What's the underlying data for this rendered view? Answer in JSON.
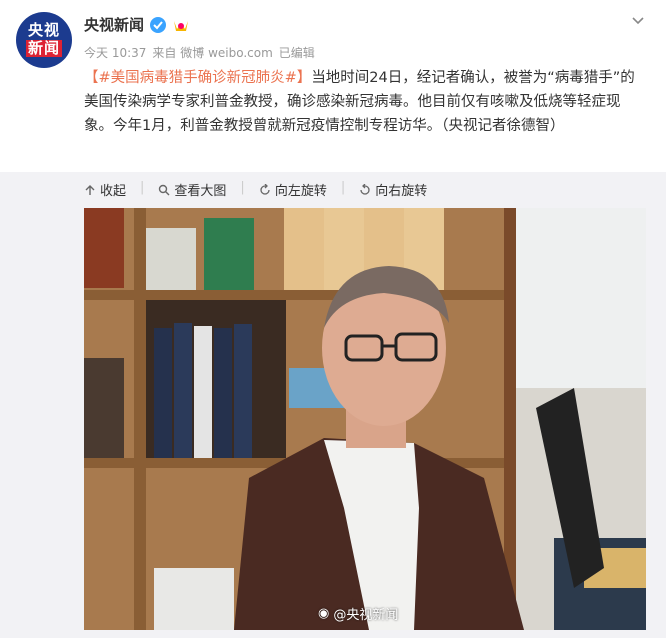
{
  "post": {
    "avatar_line1": "央视",
    "avatar_line2": "新闻",
    "user_name": "央视新闻",
    "time": "今天 10:37",
    "source_prefix": "来自",
    "source": "微博 weibo.com",
    "edited": "已编辑",
    "topic": "【#美国病毒猎手确诊新冠肺炎#】",
    "body": "当地时间24日，经记者确认，被誉为“病毒猎手”的美国传染病学专家利普金教授，确诊感染新冠病毒。他目前仅有咳嗽及低烧等轻症现象。今年1月，利普金教授曾就新冠疫情控制专程访华。（央视记者徐德智）"
  },
  "toolbar": {
    "collapse": "收起",
    "view_large": "查看大图",
    "rotate_left": "向左旋转",
    "rotate_right": "向右旋转"
  },
  "image": {
    "watermark": "@央视新闻"
  },
  "colors": {
    "topic": "#eb7350",
    "verify": "#3aa3ff",
    "panel_bg": "#f2f2f5"
  }
}
